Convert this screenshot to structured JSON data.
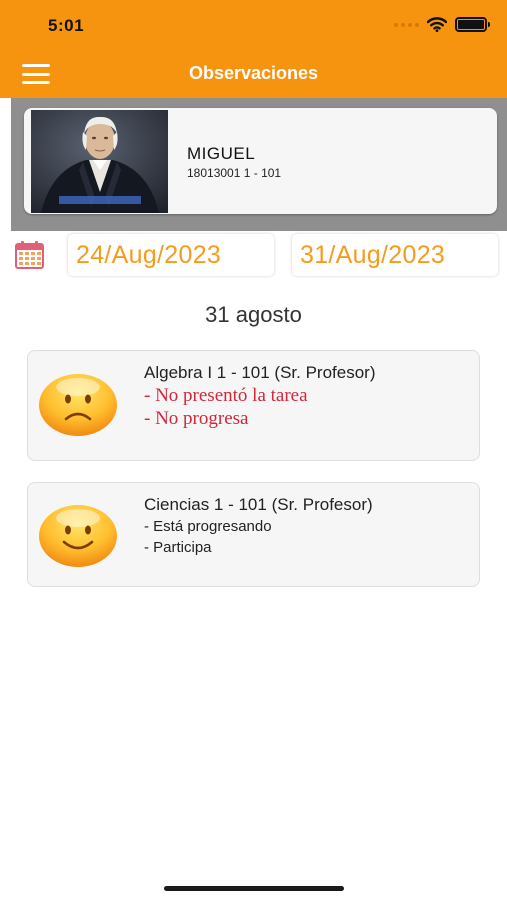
{
  "status_bar": {
    "time": "5:01",
    "battery_level": 1.0
  },
  "header": {
    "title": "Observaciones",
    "menu_icon": "hamburger-menu-icon"
  },
  "profile": {
    "name": "MIGUEL",
    "id_group": "18013001 1 - 101"
  },
  "date_range": {
    "from": "24/Aug/2023",
    "to": "31/Aug/2023",
    "calendar_icon": "calendar-icon"
  },
  "day_label": "31 agosto",
  "observations": [
    {
      "title": "Algebra I 1 - 101 (Sr. Profesor)",
      "mood": "sad",
      "notes": [
        "- No presentó la tarea",
        "- No progresa"
      ],
      "note_color": "#d0283a"
    },
    {
      "title": "Ciencias 1 - 101 (Sr. Profesor)",
      "mood": "happy",
      "notes": [
        "- Está progresando",
        "- Participa"
      ],
      "note_color": "#222222"
    }
  ],
  "colors": {
    "accent": "#f7940f",
    "date_text": "#f59c1d",
    "profile_band": "#8f8f8f"
  }
}
